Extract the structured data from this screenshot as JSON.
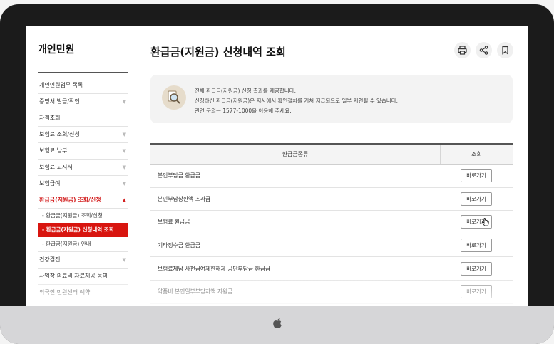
{
  "sidebar": {
    "title": "개인민원",
    "items": [
      {
        "label": "개인민원업무 목록",
        "chevron": false
      },
      {
        "label": "증명서 발급/확인",
        "chevron": true
      },
      {
        "label": "자격조회",
        "chevron": false
      },
      {
        "label": "보험료 조회/신청",
        "chevron": true
      },
      {
        "label": "보험료 납부",
        "chevron": true
      },
      {
        "label": "보험료 고지서",
        "chevron": true
      },
      {
        "label": "보험급여",
        "chevron": true
      },
      {
        "label": "환급금(지원금) 조회/신청",
        "chevron": true,
        "active": true
      }
    ],
    "subitems": [
      {
        "label": "환급금(지원금) 조회/신청"
      },
      {
        "label": "환급금(지원금) 신청내역 조회",
        "selected": true
      },
      {
        "label": "환급금(지원금) 안내"
      }
    ],
    "items_after": [
      {
        "label": "건강검진",
        "chevron": true
      },
      {
        "label": "사업장 의료비 자료제공 동의",
        "chevron": false
      },
      {
        "label": "외국인 민원센터 예약",
        "chevron": false
      }
    ]
  },
  "main": {
    "title": "환급금(지원금) 신청내역 조회",
    "tools": [
      "printer-icon",
      "share-icon",
      "bookmark-icon"
    ],
    "info": {
      "lines": [
        "전체 환급금(지원금) 신청 결과를 제공합니다.",
        "신청하신 환급금(지원금)은 지사에서 확인절차를 거쳐 지급되므로 일부 지연될 수 있습니다.",
        "관련 문의는 1577-1000을 이용해 주세요."
      ]
    },
    "table": {
      "headers": [
        "환급금종류",
        "조회"
      ],
      "button_label": "바로가기",
      "rows": [
        "본인부담금 환급금",
        "본인부담상한액 초과금",
        "보험료 환급금",
        "기타징수금 환급금",
        "보험료체납 사전급여제한해제 공단부담금 환급금",
        "약품비 본인일부부담차액 지원금"
      ]
    }
  },
  "colors": {
    "accent": "#d8150f",
    "frame": "#1b1b1b"
  }
}
